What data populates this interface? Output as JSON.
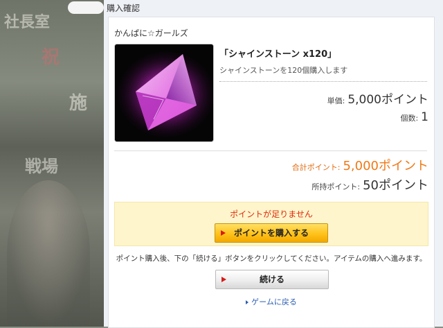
{
  "background": {
    "signs": [
      "社長室",
      "祝",
      "施",
      "戦場"
    ]
  },
  "header": {
    "title": "購入確認"
  },
  "item": {
    "game_name": "かんぱに☆ガールズ",
    "name": "「シャインストーン x120」",
    "description": "シャインストーンを120個購入します",
    "unit_price_label": "単価:",
    "unit_price_value": "5,000ポイント",
    "count_label": "個数:",
    "count_value": "1"
  },
  "totals": {
    "total_label": "合計ポイント:",
    "total_value": "5,000ポイント",
    "owned_label": "所持ポイント:",
    "owned_value": "50ポイント"
  },
  "warning": {
    "text": "ポイントが足りません",
    "buy_button": "ポイントを購入する"
  },
  "note": "ポイント購入後、下の「続ける」ボタンをクリックしてください。アイテムの購入へ進みます。",
  "continue_button": "続ける",
  "back_link": "ゲームに戻る",
  "colors": {
    "accent_orange": "#f07814",
    "warning_red": "#dd2a0a",
    "link_blue": "#2a5db0"
  },
  "icons": [
    "arrow-right-icon",
    "caret-right-icon",
    "gem-icon"
  ]
}
